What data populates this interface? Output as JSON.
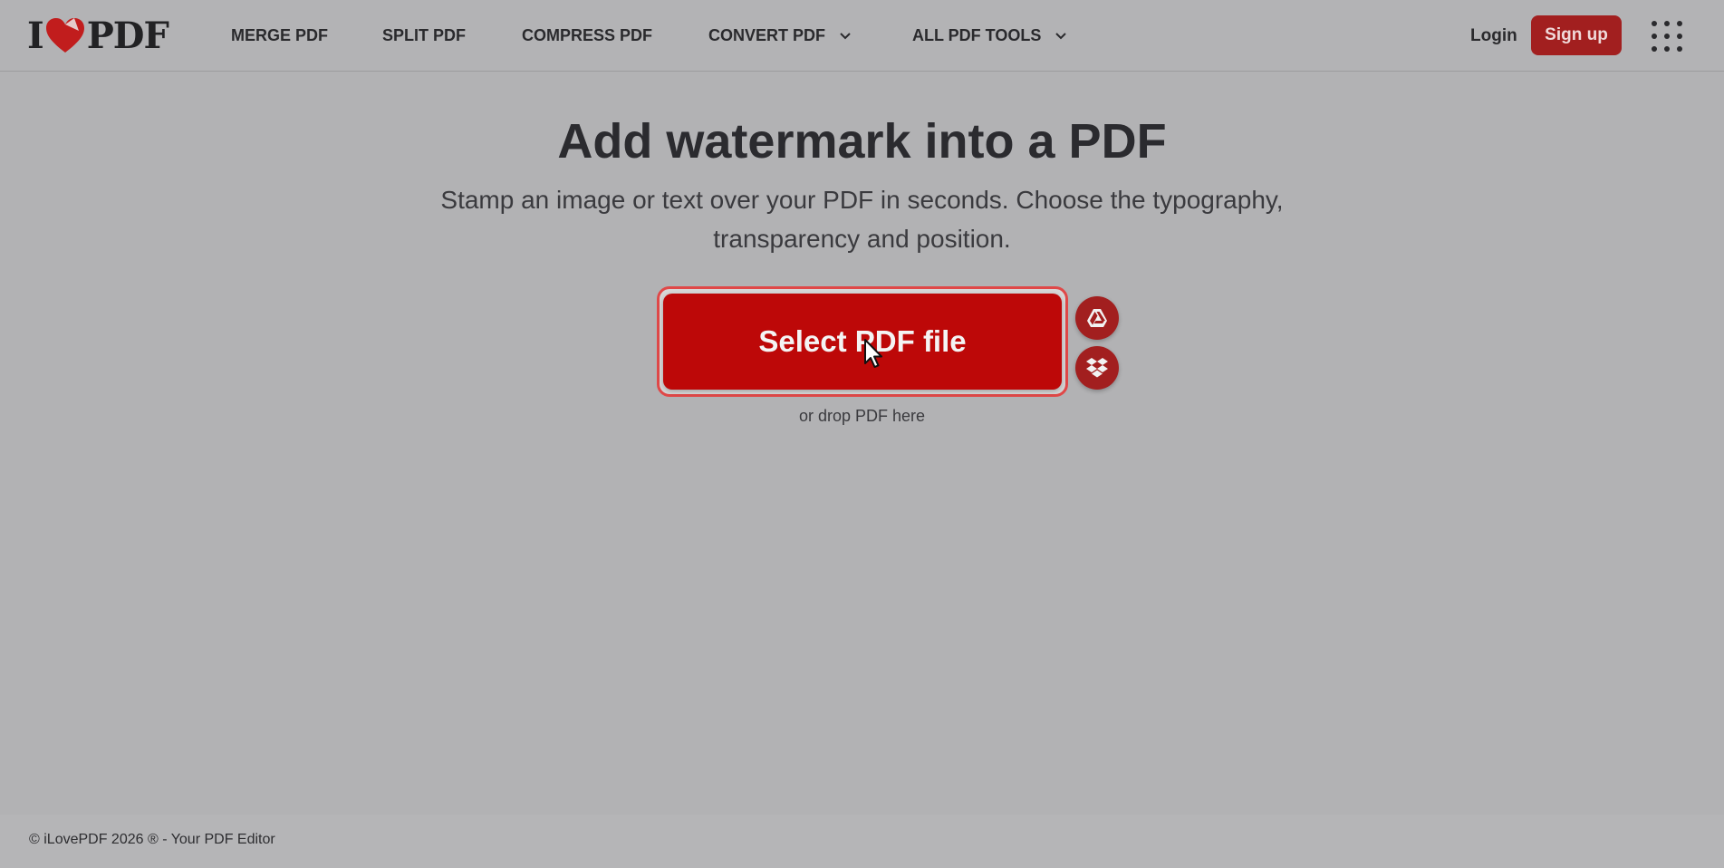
{
  "brand": {
    "logo_left": "I",
    "logo_right": "PDF",
    "accent": "#bd0808",
    "accent_dark": "#a21f1f"
  },
  "nav": {
    "items": [
      {
        "label": "MERGE PDF",
        "dropdown": false
      },
      {
        "label": "SPLIT PDF",
        "dropdown": false
      },
      {
        "label": "COMPRESS PDF",
        "dropdown": false
      },
      {
        "label": "CONVERT PDF",
        "dropdown": true
      },
      {
        "label": "ALL PDF TOOLS",
        "dropdown": true
      }
    ],
    "login": "Login",
    "signup": "Sign up",
    "apps_icon": "grid-icon"
  },
  "main": {
    "title": "Add watermark into a PDF",
    "subtitle": "Stamp an image or text over your PDF in seconds. Choose the typography, transparency and position.",
    "select_button": "Select PDF file",
    "drop_hint": "or drop PDF here",
    "cloud_buttons": [
      "google-drive-icon",
      "dropbox-icon"
    ]
  },
  "footer": {
    "copyright": "© iLovePDF 2026 ® - Your PDF Editor"
  }
}
